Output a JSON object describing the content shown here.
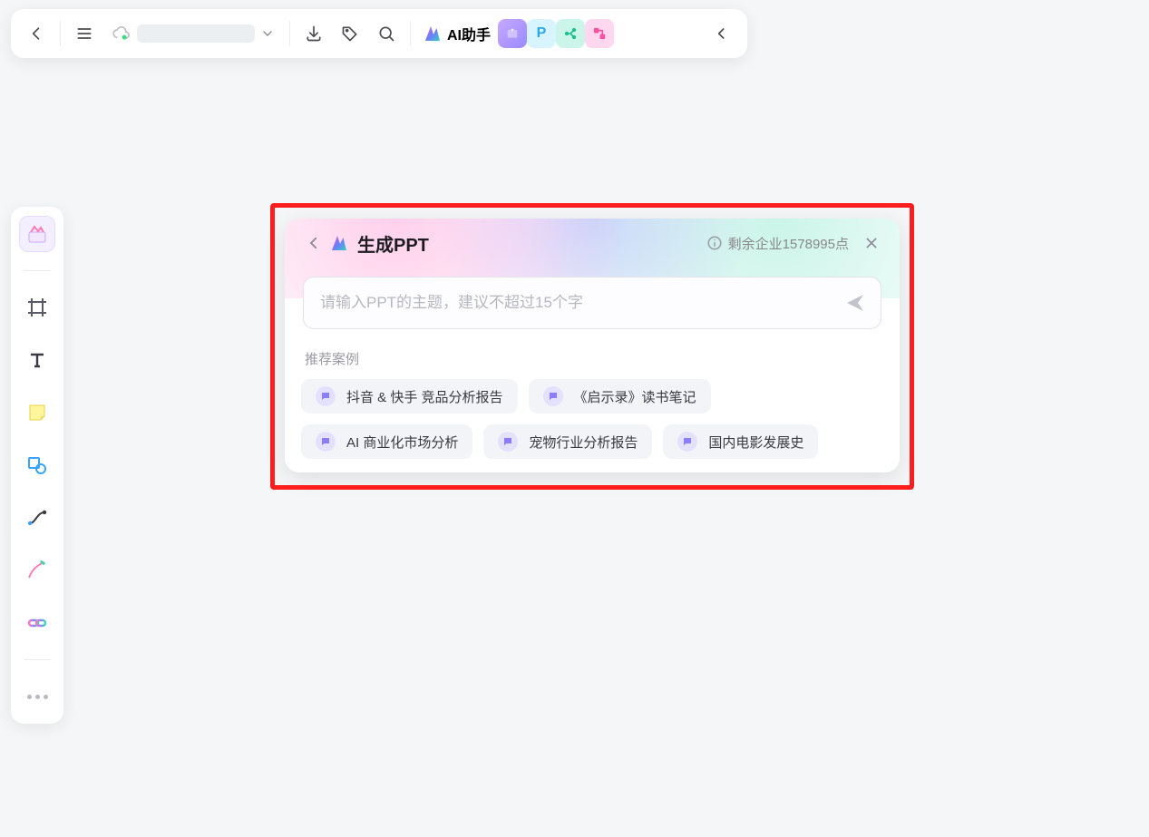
{
  "toolbar": {
    "ai_label": "AI助手",
    "chips": {
      "p": "P"
    }
  },
  "panel": {
    "title": "生成PPT",
    "quota": "剩余企业1578995点",
    "placeholder": "请输入PPT的主题，建议不超过15个字",
    "rec_label": "推荐案例",
    "recommendations": [
      "抖音 & 快手 竞品分析报告",
      "《启示录》读书笔记",
      "AI 商业化市场分析",
      "宠物行业分析报告",
      "国内电影发展史"
    ]
  }
}
